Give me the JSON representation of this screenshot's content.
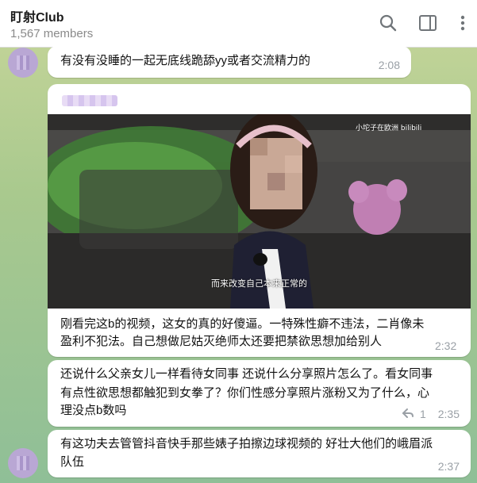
{
  "header": {
    "title": "盯射Club",
    "members": "1,567 members",
    "icons": [
      "search-icon",
      "sidebar-toggle-icon",
      "more-vert-icon"
    ]
  },
  "messages": [
    {
      "text": "有没有没睡的一起无底线跪舔yy或者交流精力的",
      "time": "2:08"
    },
    {
      "video": {
        "subtitle": "而来改变自己本来正常的",
        "watermark": "小坨子在欧洲 bilibili"
      },
      "text_line1": "刚看完这b的视频，这女的真的好傻逼。一特殊性癖不违法，二肖像未",
      "text_line2": "盈利不犯法。自己想做尼姑灭绝师太还要把禁欲思想加给别人",
      "time": "2:32"
    },
    {
      "text_line1": "还说什么父亲女儿一样看待女同事 还说什么分享照片怎么了。看女同事",
      "text_line2": "有点性欲思想都触犯到女拳了？你们性感分享照片涨粉又为了什么，心",
      "text_line3": "理没点b数吗",
      "replies": "1",
      "time": "2:35"
    },
    {
      "text_line1": "有这功夫去管管抖音快手那些婊子拍擦边球视频的 好壮大他们的峨眉派",
      "text_line2": "队伍",
      "time": "2:37"
    }
  ],
  "colors": {
    "accent": "#3390ec",
    "bubble": "#ffffff",
    "time": "#9aa0a6"
  }
}
